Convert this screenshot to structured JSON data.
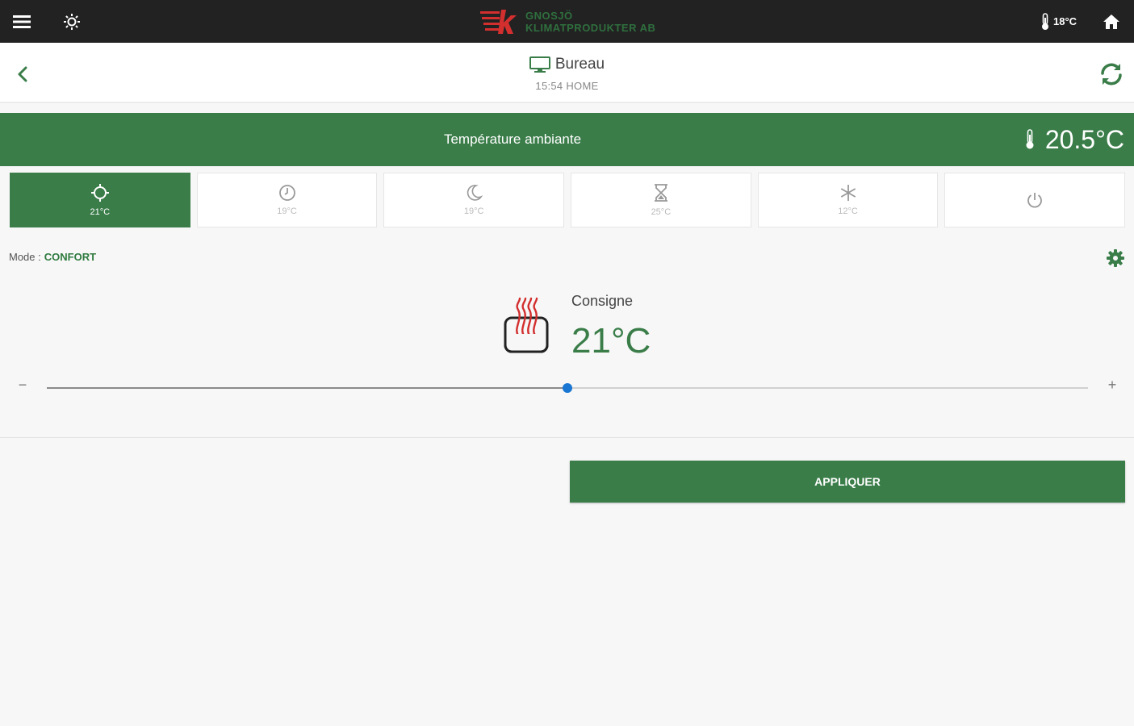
{
  "topbar": {
    "brand_line1": "GNOSJÖ",
    "brand_line2": "KLIMATPRODUKTER AB",
    "brand_letter": "k",
    "outdoor_temp": "18°C"
  },
  "header": {
    "room_name": "Bureau",
    "subtitle": "15:54 HOME"
  },
  "ambient": {
    "label": "Température ambiante",
    "value": "20.5°C"
  },
  "modes": [
    {
      "icon": "sun-icon",
      "temp": "21°C",
      "active": true
    },
    {
      "icon": "clock-icon",
      "temp": "19°C",
      "active": false
    },
    {
      "icon": "moon-icon",
      "temp": "19°C",
      "active": false
    },
    {
      "icon": "hourglass-icon",
      "temp": "25°C",
      "active": false
    },
    {
      "icon": "snowflake-icon",
      "temp": "12°C",
      "active": false
    },
    {
      "icon": "power-icon",
      "temp": "",
      "active": false
    }
  ],
  "mode_info": {
    "label": "Mode :",
    "value": "CONFORT"
  },
  "setpoint": {
    "label": "Consigne",
    "value": "21°C",
    "slider_fraction": 0.5
  },
  "controls": {
    "minus": "−",
    "plus": "+"
  },
  "apply_label": "APPLIQUER",
  "colors": {
    "topbar": "#222222",
    "accent_green": "#3a7d49",
    "slider_thumb": "#1976d2",
    "heater_red": "#d32f2f"
  }
}
